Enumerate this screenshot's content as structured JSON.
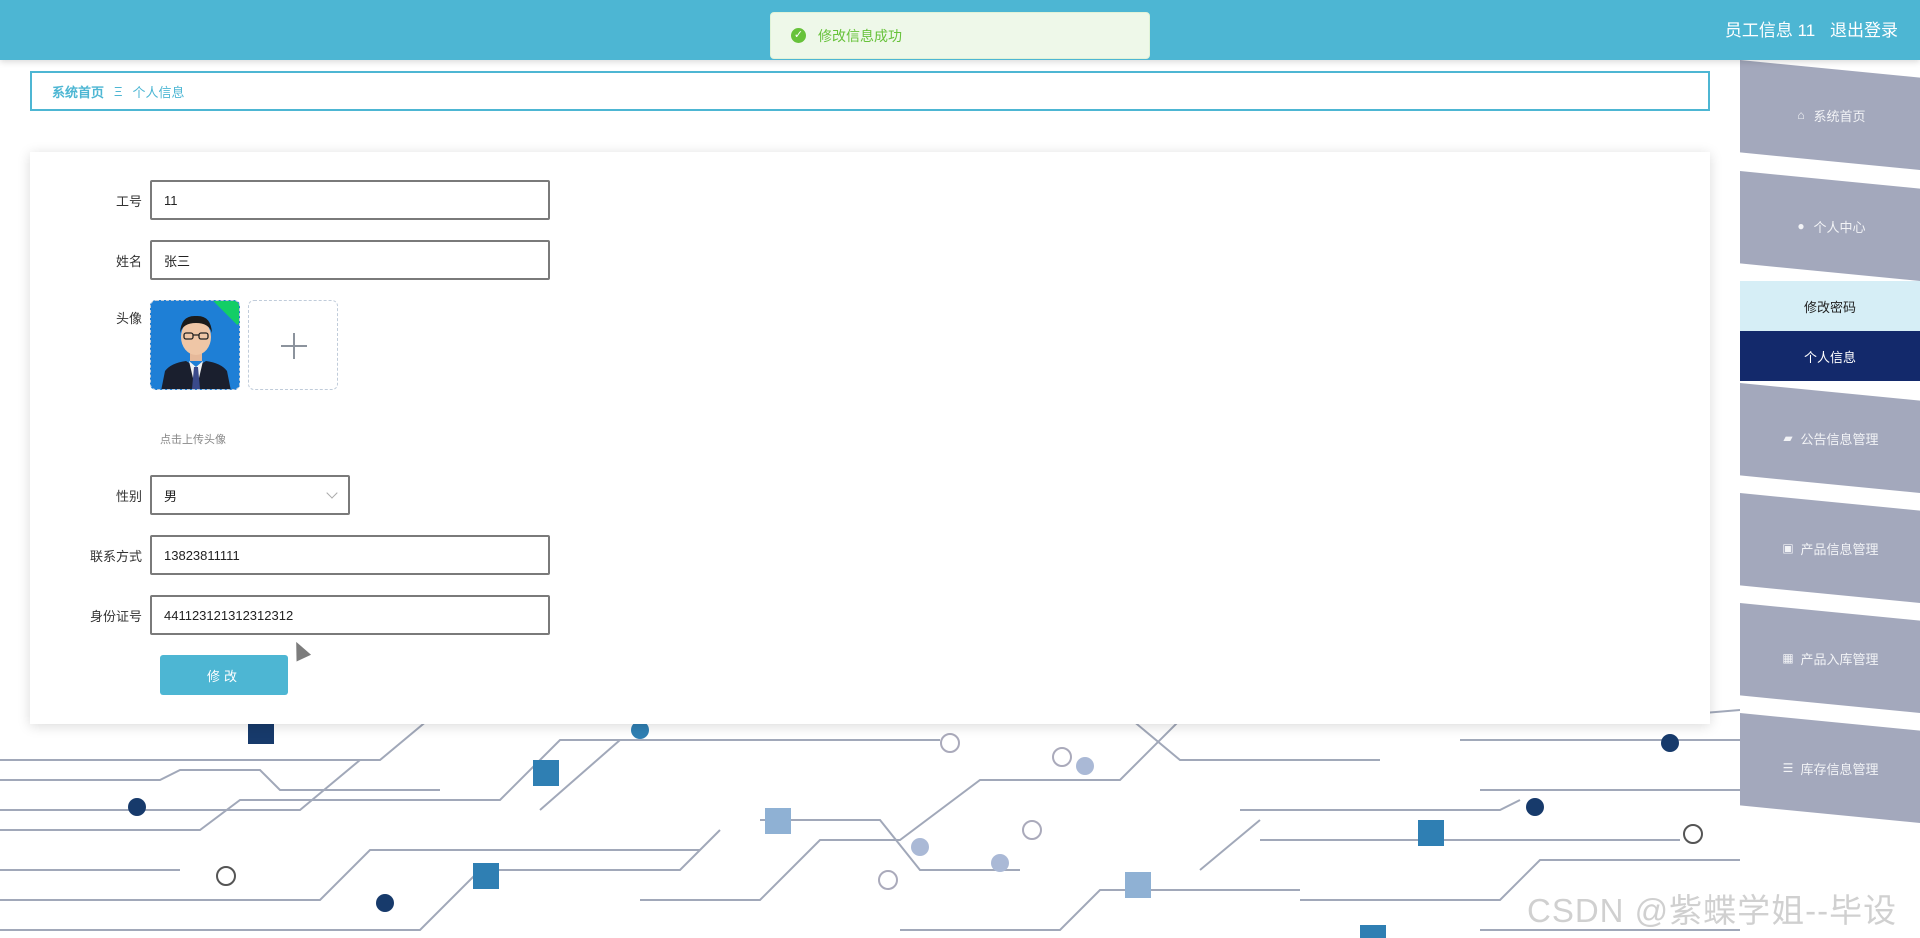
{
  "header": {
    "user_label": "员工信息 11",
    "logout_label": "退出登录",
    "bg_color": "#4db6d3"
  },
  "toast": {
    "message": "修改信息成功",
    "icon": "success-check-icon",
    "color": "#67c23a"
  },
  "breadcrumb": {
    "home": "系统首页",
    "separator": "Ξ",
    "current": "个人信息"
  },
  "form": {
    "employee_id": {
      "label": "工号",
      "value": "11"
    },
    "name": {
      "label": "姓名",
      "value": "张三"
    },
    "avatar": {
      "label": "头像",
      "hint": "点击上传头像"
    },
    "gender": {
      "label": "性别",
      "value": "男"
    },
    "phone": {
      "label": "联系方式",
      "value": "13823811111"
    },
    "id_card": {
      "label": "身份证号",
      "value": "441123121312312312"
    },
    "submit_label": "修改"
  },
  "sidebar": {
    "items": [
      {
        "label": "系统首页",
        "icon": "home-icon"
      },
      {
        "label": "个人中心",
        "icon": "user-icon"
      },
      {
        "label": "修改密码"
      },
      {
        "label": "个人信息",
        "active": true
      },
      {
        "label": "公告信息管理",
        "icon": "announcement-icon"
      },
      {
        "label": "产品信息管理",
        "icon": "briefcase-icon"
      },
      {
        "label": "产品入库管理",
        "icon": "grid-icon"
      },
      {
        "label": "库存信息管理",
        "icon": "list-icon"
      }
    ],
    "active_color": "#13296b",
    "item_color": "#a3a8bc"
  },
  "watermark": "CSDN @紫蝶学姐--毕设"
}
